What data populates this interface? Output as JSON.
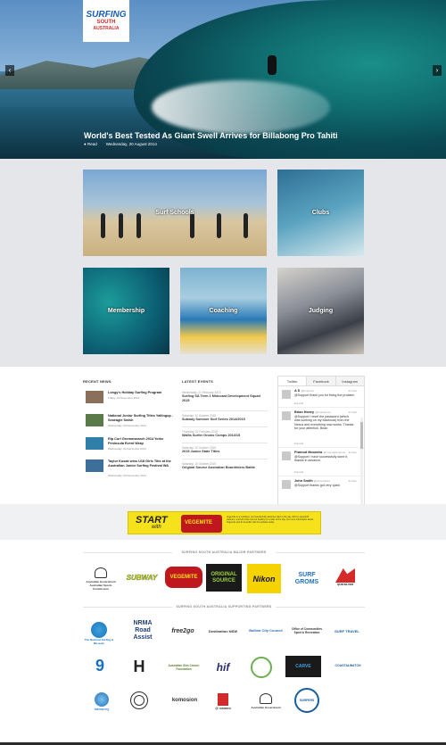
{
  "hero": {
    "logo": {
      "line1": "SURFING",
      "line2": "SOUTH",
      "line3": "AUSTRALIA"
    },
    "title": "World's Best Tested As Giant Swell Arrives for Billabong Pro Tahiti",
    "read_label": "Read",
    "date": "Wednesday, 20 August 2014",
    "prev_arrow": "‹",
    "next_arrow": "›"
  },
  "tiles": [
    {
      "label": "Surf Schools"
    },
    {
      "label": "Clubs"
    },
    {
      "label": "Membership"
    },
    {
      "label": "Coaching"
    },
    {
      "label": "Judging"
    }
  ],
  "recent_news": {
    "heading": "RECENT NEWS",
    "items": [
      {
        "title": "Longy's Holiday Surfing Program",
        "date": "Friday, 19 December 2014",
        "color": "#8a6f5a"
      },
      {
        "title": "National Junior Surfing Titles Yallingup - Seaeagle Swish",
        "date": "Wednesday, 03 December 2014",
        "color": "#5a7a4a"
      },
      {
        "title": "Rip Curl Grommsearch 2014 Yorke Peninsula Event Wrap",
        "date": "Wednesday, 03 December 2014",
        "color": "#2f7fa8"
      },
      {
        "title": "Taylor Kusak wins U18 Girls Title at the Australian Junior Surfing Festival WA",
        "date": "Wednesday, 03 December 2014",
        "color": "#3e6f9a"
      }
    ]
  },
  "latest_events": {
    "heading": "LATEST EVENTS",
    "items": [
      {
        "date": "Wednesday, 21 February 2015",
        "title": "Surfing SA Term 1 Midcoast Development Squad 2015"
      },
      {
        "date": "Saturday, 10 October 2015",
        "title": "Subway Summer Surf Series 2014/2015"
      },
      {
        "date": "Thursday, 21 February 2015",
        "title": "Wallis Surfer Groms Comps 2014/15"
      },
      {
        "date": "Saturday, 10 October 2015",
        "title": "2015 Junior State Titles"
      },
      {
        "date": "Saturday, 10 October 2015",
        "title": "Original Source Australian Boardriders Battle"
      }
    ]
  },
  "social": {
    "tabs": [
      "Twitter",
      "Facebook",
      "Instagram"
    ],
    "tweets": [
      {
        "name": "A S",
        "handle": "@fourpoint",
        "date": "31 Dec",
        "text": "@Support thank you for fixing the problem",
        "expand": "Expand"
      },
      {
        "name": "Brian Hovey",
        "handle": "@brianhovey",
        "date": "31 Dec",
        "text": "@Support I reset the password (which was working on my Macbook) from the Nexus and everything now works. Thanks for your attention. Brian",
        "expand": "Expand"
      },
      {
        "name": "Pramod Moondra",
        "handle": "@moondrapramod",
        "date": "31 Dec",
        "text": "@Support I have successfully done it, thanks in advance.",
        "expand": "Expand"
      },
      {
        "name": "John Smith",
        "handle": "@johnsmitten",
        "date": "31 Dec",
        "text": "@Support thanks got very quick",
        "expand": ""
      }
    ]
  },
  "banner": {
    "start": "START",
    "with": "with",
    "brand": "VEGEMITE",
    "copy": "Vegemite is a nutritious, and wonderfully delicious start to the day. Rich in special B vitamins, and full of the nice bit healthy for a start of the day. For more information about Vegemite and its benefits visit the website today."
  },
  "partners": {
    "major_heading": "SURFING SOUTH AUSTRALIA MAJOR PARTNERS",
    "supporting_heading": "SURFING SOUTH AUSTRALIA SUPPORTING PARTNERS",
    "major": [
      {
        "name": "Australian Government",
        "text": "Australian Government Australian Sports Commission"
      },
      {
        "name": "Subway",
        "text": "SUBWAY"
      },
      {
        "name": "Vegemite",
        "text": "VEGEMITE"
      },
      {
        "name": "Original Source",
        "text": "ORIGINAL SOURCE"
      },
      {
        "name": "Nikon",
        "text": "Nikon"
      },
      {
        "name": "Surf Groms",
        "text": "SURF GROMS"
      },
      {
        "name": "Quiksilver",
        "text": "QUIKSILVER"
      }
    ],
    "supporting": [
      {
        "name": "National Surf Museum",
        "text": "The National Surfing & Museum"
      },
      {
        "name": "NRMA Road Assist",
        "text": "NRMA Road Assist"
      },
      {
        "name": "Free2Go",
        "text": "free2go"
      },
      {
        "name": "Destination NSW",
        "text": "Destination NSW"
      },
      {
        "name": "Ballarat City Council",
        "text": "Ballina City Council"
      },
      {
        "name": "NSW Office of Communities",
        "text": "Office of Communities Sport & Recreation"
      },
      {
        "name": "Surf Travel",
        "text": "SURF TRAVEL"
      },
      {
        "name": "Channel 9",
        "text": "9"
      },
      {
        "name": "Hurley",
        "text": "H"
      },
      {
        "name": "Australian Skin Cancer",
        "text": "Australian Skin Cancer Foundation"
      },
      {
        "name": "HIF",
        "text": "hif"
      },
      {
        "name": "Sports",
        "text": ""
      },
      {
        "name": "Carve",
        "text": "CARVE"
      },
      {
        "name": "Surf Life",
        "text": ""
      },
      {
        "name": "Coastal Watch",
        "text": "COASTALWATCH"
      },
      {
        "name": "Hamurey",
        "text": "hamurey"
      },
      {
        "name": "Circle Brand",
        "text": ""
      },
      {
        "name": "Komosion",
        "text": "komosion"
      },
      {
        "name": "Vimeo Camera",
        "text": "@ cameo"
      },
      {
        "name": "Government Crest",
        "text": "Australian Government"
      },
      {
        "name": "Surfers Club",
        "text": "SURFERS"
      }
    ]
  }
}
